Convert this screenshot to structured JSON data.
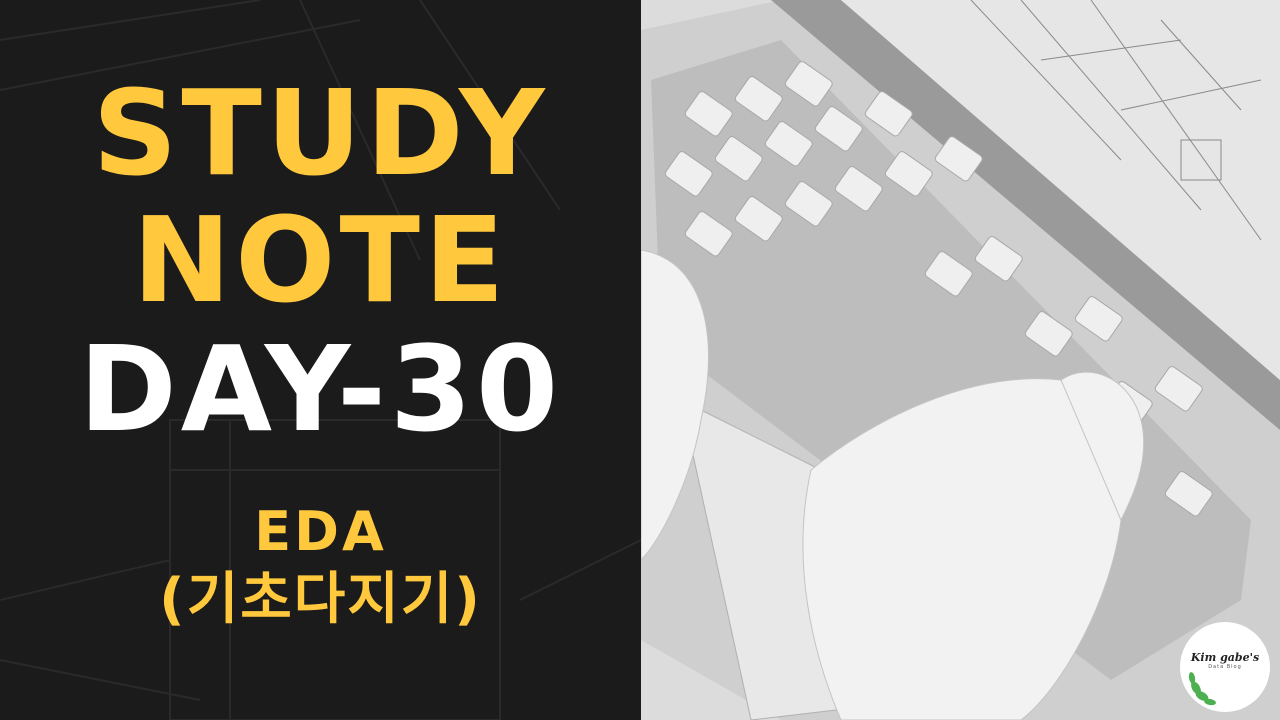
{
  "title": {
    "line1": "STUDY",
    "line2": "NOTE",
    "line3": "DAY-30"
  },
  "subtitle": {
    "line1": "EDA",
    "line2": "(기초다지기)"
  },
  "logo": {
    "name": "Kim gabe's",
    "tagline": "Data Blog"
  },
  "colors": {
    "accent": "#ffc83d",
    "left_background": "#1b1b1b",
    "headline_white": "#ffffff"
  },
  "icons": [
    "laptop-keyboard-photo",
    "hands-typing-photo",
    "leaf-icon"
  ]
}
